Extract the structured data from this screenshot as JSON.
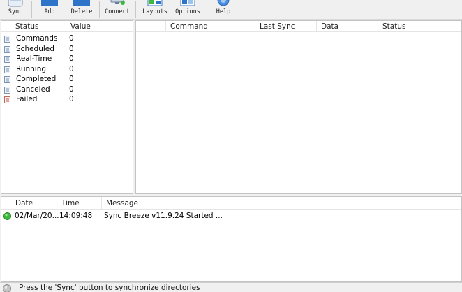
{
  "toolbar": {
    "buttons": [
      {
        "label": "Sync",
        "icon": "sync-icon"
      },
      {
        "label": "Add",
        "icon": "add-icon"
      },
      {
        "label": "Delete",
        "icon": "delete-icon"
      },
      {
        "label": "Connect",
        "icon": "connect-icon"
      },
      {
        "label": "Layouts",
        "icon": "layouts-icon"
      },
      {
        "label": "Options",
        "icon": "options-icon"
      },
      {
        "label": "Help",
        "icon": "help-icon"
      }
    ]
  },
  "stats_panel": {
    "columns": [
      "Status",
      "Value"
    ],
    "rows": [
      {
        "status": "Commands",
        "value": "0"
      },
      {
        "status": "Scheduled",
        "value": "0"
      },
      {
        "status": "Real-Time",
        "value": "0"
      },
      {
        "status": "Running",
        "value": "0"
      },
      {
        "status": "Completed",
        "value": "0"
      },
      {
        "status": "Canceled",
        "value": "0"
      },
      {
        "status": "Failed",
        "value": "0"
      }
    ]
  },
  "commands_panel": {
    "columns": [
      "",
      "Command",
      "Last Sync",
      "Data",
      "Status"
    ]
  },
  "log_panel": {
    "columns": [
      "Date",
      "Time",
      "Message"
    ],
    "rows": [
      {
        "date": "02/Mar/20...",
        "time": "14:09:48",
        "message": "Sync Breeze v11.9.24 Started ..."
      }
    ]
  },
  "statusbar": {
    "text": "Press the 'Sync' button to synchronize directories"
  },
  "colors": {
    "ok_green": "#3cb83c",
    "icon_blue": "#2e74c8",
    "failed_red": "#d04a3a"
  }
}
